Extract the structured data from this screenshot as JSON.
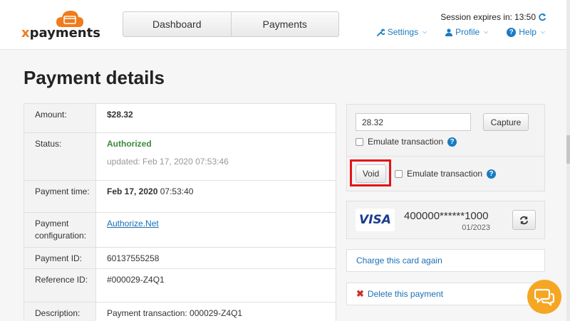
{
  "header": {
    "logo": {
      "text_x": "x",
      "text_rest": "payments"
    },
    "nav": [
      {
        "label": "Dashboard"
      },
      {
        "label": "Payments"
      }
    ],
    "session_label": "Session expires in:",
    "session_time": "13:50",
    "links": {
      "settings": "Settings",
      "profile": "Profile",
      "help": "Help"
    }
  },
  "page": {
    "title": "Payment details"
  },
  "details": {
    "amount": {
      "label": "Amount:",
      "value": "$28.32"
    },
    "status": {
      "label": "Status:",
      "value": "Authorized",
      "updated": "updated: Feb 17, 2020 07:53:46"
    },
    "payment_time": {
      "label": "Payment time:",
      "date": "Feb 17, 2020",
      "time": "07:53:40"
    },
    "payment_configuration": {
      "label": "Payment configuration:",
      "value": "Authorize.Net"
    },
    "payment_id": {
      "label": "Payment ID:",
      "value": "60137555258"
    },
    "reference_id": {
      "label": "Reference ID:",
      "value": "#000029-Z4Q1"
    },
    "description": {
      "label": "Description:",
      "value": "Payment transaction: 000029-Z4Q1"
    }
  },
  "actions": {
    "capture_amount": "28.32",
    "capture_label": "Capture",
    "emulate_label": "Emulate transaction",
    "void_label": "Void",
    "help_glyph": "?"
  },
  "card": {
    "brand": "VISA",
    "number": "400000******1000",
    "expiry": "01/2023"
  },
  "links": {
    "charge_again": "Charge this card again",
    "delete": "Delete this payment"
  },
  "colors": {
    "accent": "#1a7bc2",
    "highlight": "#e3141b",
    "chat": "#f5a623",
    "brand": "#f07b1c"
  }
}
